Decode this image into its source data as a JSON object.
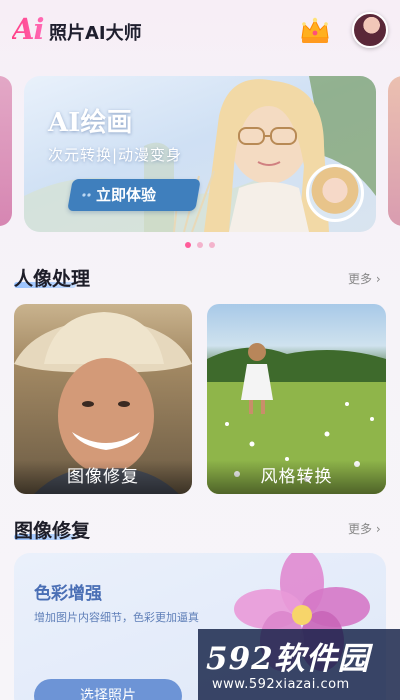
{
  "header": {
    "logo_ai": "Ai",
    "app_title": "照片AI大师"
  },
  "banner": {
    "title": "AI绘画",
    "subtitle": "次元转换|动漫变身",
    "button_label": "立即体验"
  },
  "carousel": {
    "active_index": 0,
    "count": 3
  },
  "sections": {
    "portrait": {
      "title": "人像处理",
      "more_label": "更多",
      "cards": [
        {
          "label": "图像修复"
        },
        {
          "label": "风格转换"
        }
      ]
    },
    "restore": {
      "title": "图像修复",
      "more_label": "更多",
      "card": {
        "title": "色彩增强",
        "description": "增加图片内容细节，色彩更加逼真",
        "button_label": "选择照片"
      }
    }
  },
  "watermark": {
    "brand": "592软件园",
    "url": "www.592xiazai.com"
  },
  "colors": {
    "accent_pink": "#ff3e86",
    "banner_button": "#3f7fbd",
    "card_button": "#6d94d6",
    "dot_active": "#ff5c9a",
    "dot_inactive": "#f3b3cc"
  }
}
